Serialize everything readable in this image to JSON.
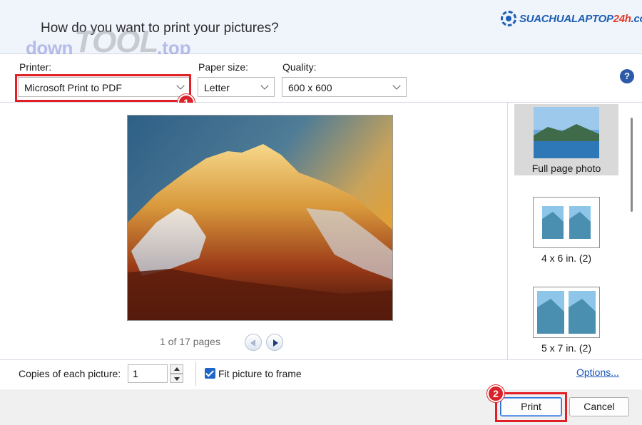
{
  "header": {
    "title": "How do you want to print your pictures?",
    "watermark": {
      "part1": "down",
      "part2": "TOOL",
      "part3": ".top"
    },
    "brand": {
      "main": "SUACHUALAPTOP",
      "accent": "24h",
      "suffix": ".com"
    }
  },
  "settings": {
    "printer_label": "Printer:",
    "printer_value": "Microsoft Print to PDF",
    "paper_label": "Paper size:",
    "paper_value": "Letter",
    "quality_label": "Quality:",
    "quality_value": "600 x 600",
    "help_glyph": "?"
  },
  "preview": {
    "page_indicator": "1 of 17 pages"
  },
  "layouts": [
    {
      "label": "Full page photo",
      "selected": true
    },
    {
      "label": "4 x 6 in. (2)",
      "selected": false
    },
    {
      "label": "5 x 7 in. (2)",
      "selected": false
    }
  ],
  "bottom": {
    "copies_label": "Copies of each picture:",
    "copies_value": "1",
    "fit_label": "Fit picture to frame",
    "fit_checked": true,
    "options_link": "Options..."
  },
  "footer": {
    "print_label": "Print",
    "cancel_label": "Cancel"
  },
  "annotations": {
    "badge1": "1",
    "badge2": "2"
  },
  "colors": {
    "highlight": "#e21f26",
    "accent": "#1f65c8",
    "link": "#1a55b8"
  }
}
